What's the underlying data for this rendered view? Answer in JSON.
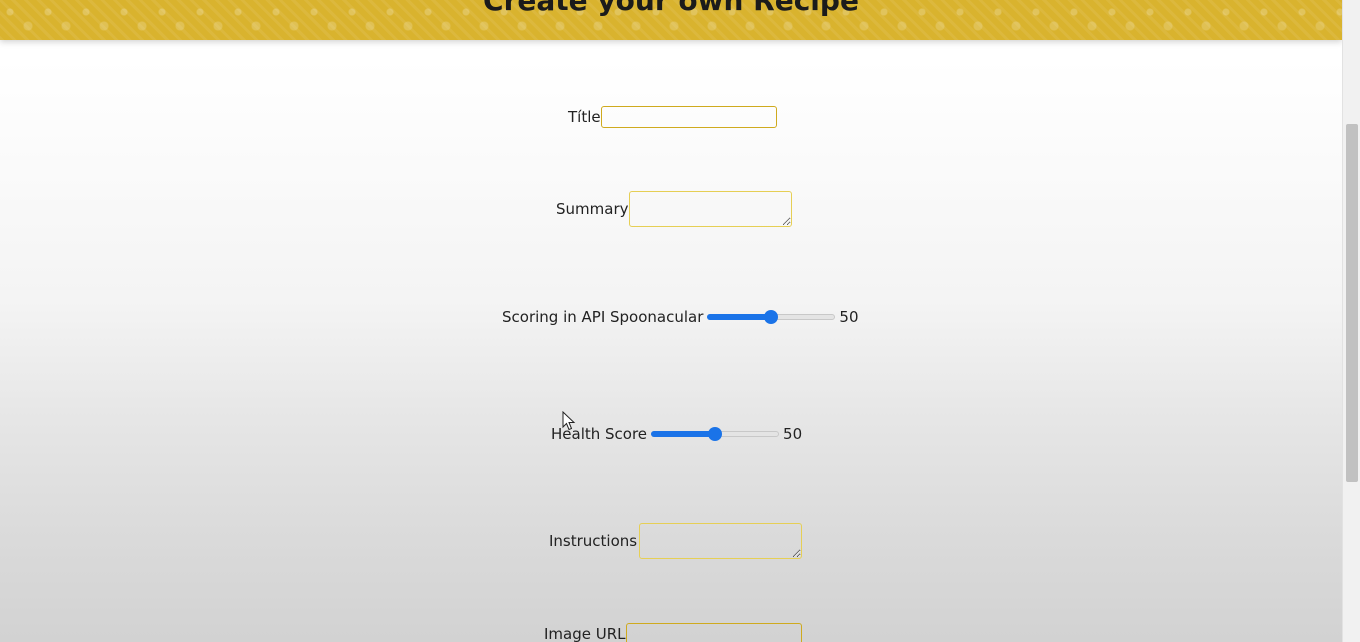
{
  "header": {
    "title": "Create your own Recipe"
  },
  "form": {
    "title_field": {
      "label": "Títle",
      "value": ""
    },
    "summary_field": {
      "label": "Summary",
      "value": ""
    },
    "score_slider": {
      "label": "Scoring in API Spoonacular",
      "value": "50",
      "fraction": 0.5
    },
    "health_slider": {
      "label": "Health Score",
      "value": "50",
      "fraction": 0.5
    },
    "instructions_field": {
      "label": "Instructions",
      "value": ""
    },
    "image_field": {
      "label": "Image URL",
      "value": ""
    }
  },
  "colors": {
    "banner": "#d9b32e",
    "input_border": "#cfaa1e",
    "slider_accent": "#1a73e8"
  },
  "icons": {
    "cursor": "arrow-cursor-icon",
    "textarea_resize": "resize-grip-icon"
  }
}
